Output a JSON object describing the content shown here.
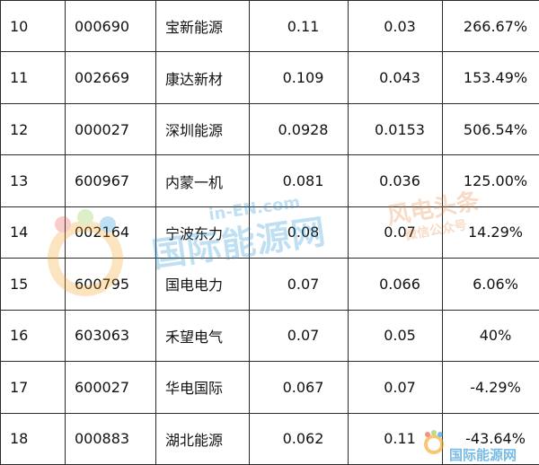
{
  "table": {
    "rows": [
      {
        "rank": "10",
        "code": "000690",
        "name": "宝新能源",
        "v1": "0.11",
        "v2": "0.03",
        "pct": "266.67%"
      },
      {
        "rank": "11",
        "code": "002669",
        "name": "康达新材",
        "v1": "0.109",
        "v2": "0.043",
        "pct": "153.49%"
      },
      {
        "rank": "12",
        "code": "000027",
        "name": "深圳能源",
        "v1": "0.0928",
        "v2": "0.0153",
        "pct": "506.54%"
      },
      {
        "rank": "13",
        "code": "600967",
        "name": "内蒙一机",
        "v1": "0.081",
        "v2": "0.036",
        "pct": "125.00%"
      },
      {
        "rank": "14",
        "code": "002164",
        "name": "宁波东力",
        "v1": "0.08",
        "v2": "0.07",
        "pct": "14.29%"
      },
      {
        "rank": "15",
        "code": "600795",
        "name": "国电电力",
        "v1": "0.07",
        "v2": "0.066",
        "pct": "6.06%"
      },
      {
        "rank": "16",
        "code": "603063",
        "name": "禾望电气",
        "v1": "0.07",
        "v2": "0.05",
        "pct": "40%"
      },
      {
        "rank": "17",
        "code": "600027",
        "name": "华电国际",
        "v1": "0.067",
        "v2": "0.07",
        "pct": "-4.29%"
      },
      {
        "rank": "18",
        "code": "000883",
        "name": "湖北能源",
        "v1": "0.062",
        "v2": "0.11",
        "pct": "-43.64%"
      }
    ]
  },
  "watermark": {
    "main_text": "国际能源网",
    "en_text": "in-EN.com",
    "side_text": "风电头条",
    "side_sub": "微信公众号",
    "bottom_text": "国际能源网"
  }
}
